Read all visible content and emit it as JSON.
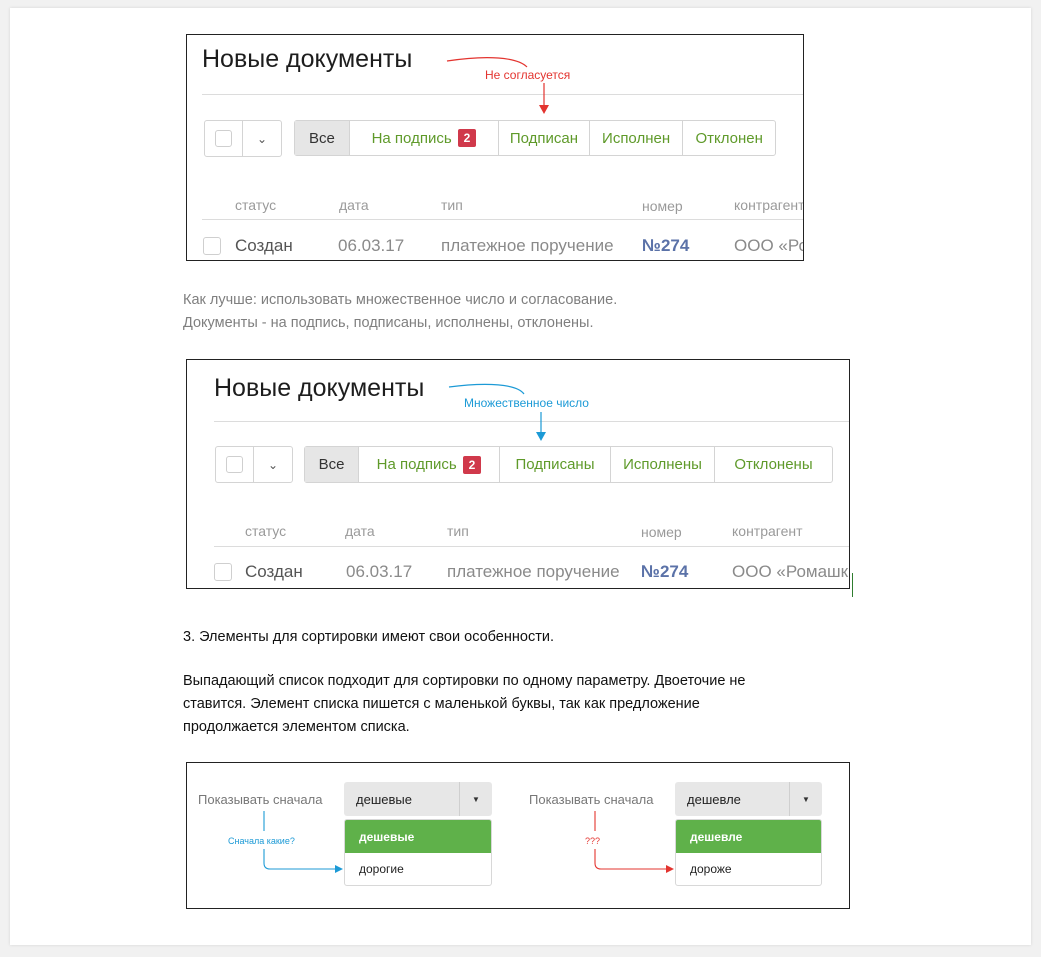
{
  "example1": {
    "title": "Новые документы",
    "annotation": "Не согласуется",
    "tabs": [
      "Все",
      "На подпись",
      "Подписан",
      "Исполнен",
      "Отклонен"
    ],
    "badge": "2",
    "chevron": "⌄",
    "columns": [
      "статус",
      "дата",
      "тип",
      "номер",
      "контрагент"
    ],
    "row": [
      "Создан",
      "06.03.17",
      "платежное поручение",
      "№274",
      "ООО «Ромашка»"
    ]
  },
  "para1": {
    "line1": "Как лучше: использовать множественное число и согласование.",
    "line2": "Документы - на подпись, подписаны, исполнены, отклонены."
  },
  "example2": {
    "title": "Новые документы",
    "annotation": "Множественное число",
    "tabs": [
      "Все",
      "На подпись",
      "Подписаны",
      "Исполнены",
      "Отклонены"
    ],
    "badge": "2",
    "chevron": "⌄",
    "columns": [
      "статус",
      "дата",
      "тип",
      "номер",
      "контрагент"
    ],
    "row": [
      "Создан",
      "06.03.17",
      "платежное поручение",
      "№274",
      "ООО «Ромашка»"
    ]
  },
  "section3": {
    "heading": "3. Элементы для сортировки имеют свои особенности.",
    "line1": "Выпадающий список подходит для сортировки по одному параметру. Двоеточие не",
    "line2": "ставится. Элемент списка пишется с маленькой буквы, так как предложение",
    "line3": "продолжается элементом списка."
  },
  "sort": {
    "left": {
      "label": "Показывать сначала",
      "selected": "дешевые",
      "caret": "▼",
      "options": [
        "дешевые",
        "дорогие"
      ],
      "annotation": "Сначала какие?"
    },
    "right": {
      "label": "Показывать сначала",
      "selected": "дешевле",
      "caret": "▼",
      "options": [
        "дешевле",
        "дороже"
      ],
      "annotation": "???"
    }
  },
  "colors": {
    "accent_green": "#5f9a2a",
    "menu_green": "#5fb14a",
    "badge_red": "#d0394b",
    "annotation_red": "#e3342f",
    "annotation_blue": "#1c9ad6",
    "number_blue": "#5b72a8"
  }
}
